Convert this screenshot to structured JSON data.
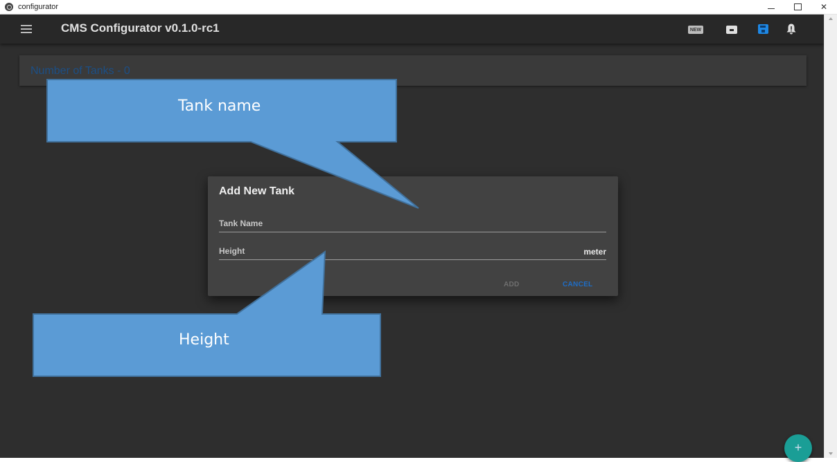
{
  "window": {
    "title": "configurator",
    "controls": {
      "minimize": "—",
      "close": "✕"
    }
  },
  "toolbar": {
    "title": "CMS Configurator v0.1.0-rc1",
    "icons": [
      "menu-icon",
      "new-icon",
      "archive-icon",
      "save-icon",
      "bell-icon"
    ],
    "new_badge": "NEW"
  },
  "panel": {
    "title": "Number of Tanks - 0"
  },
  "dialog": {
    "title": "Add New Tank",
    "fields": {
      "tank_name": {
        "placeholder": "Tank Name",
        "value": ""
      },
      "height": {
        "placeholder": "Height",
        "value": "",
        "unit": "meter"
      }
    },
    "buttons": {
      "add": "ADD",
      "cancel": "CANCEL"
    }
  },
  "fab": {
    "label": "+"
  },
  "callouts": {
    "tank_name": "Tank name",
    "height": "Height"
  },
  "colors": {
    "background": "#2e2e2e",
    "toolbar": "#282828",
    "dialog": "#424242",
    "accent_blue": "#1e6ec8",
    "fab": "#1a9e96",
    "callout": "#5b9bd5"
  }
}
